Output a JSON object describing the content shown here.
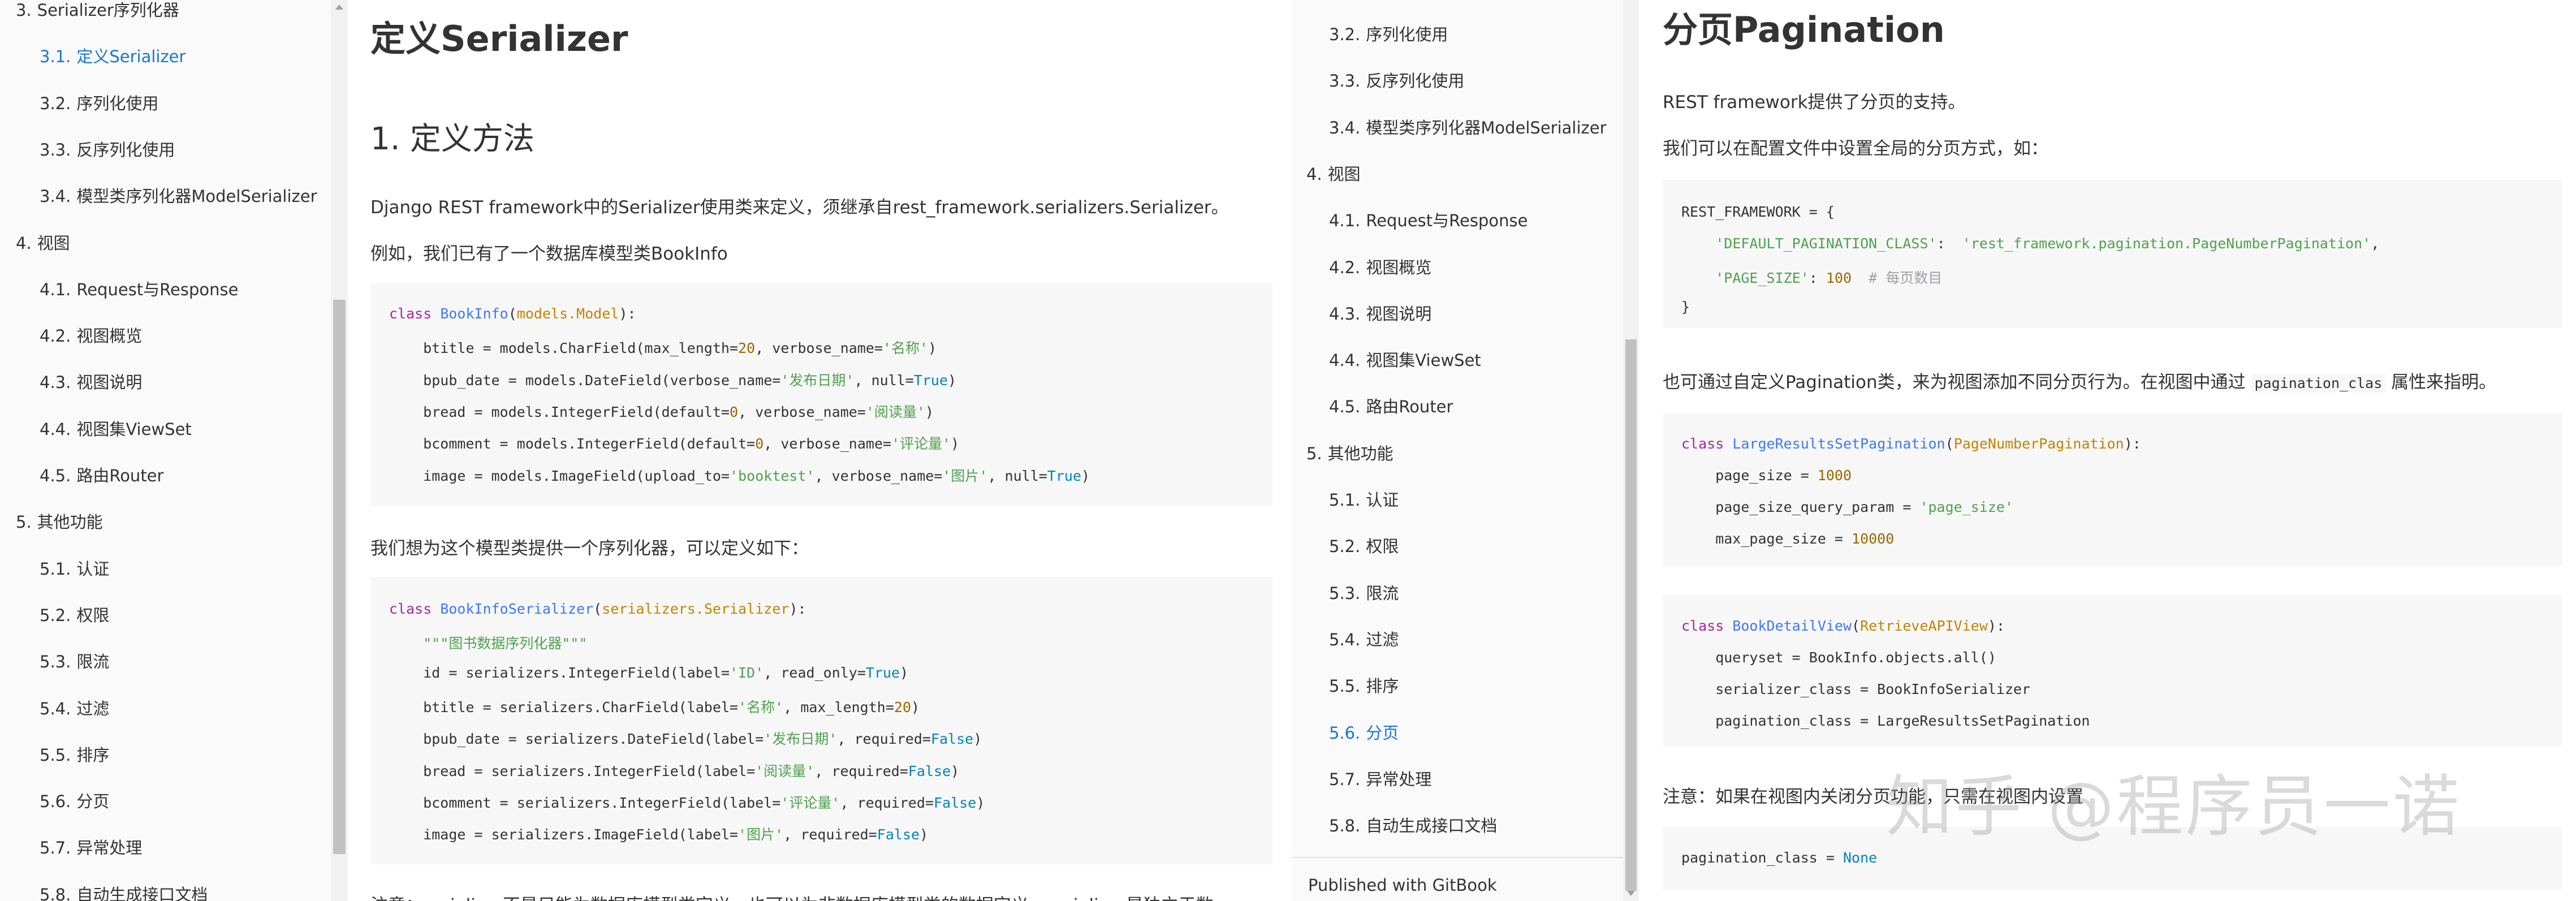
{
  "left_panel": {
    "toc": [
      {
        "num": "3.",
        "label": "Serializer序列化器",
        "level": 1,
        "active": false
      },
      {
        "num": "3.1.",
        "label": "定义Serializer",
        "level": 2,
        "active": true
      },
      {
        "num": "3.2.",
        "label": "序列化使用",
        "level": 2,
        "active": false
      },
      {
        "num": "3.3.",
        "label": "反序列化使用",
        "level": 2,
        "active": false
      },
      {
        "num": "3.4.",
        "label": "模型类序列化器ModelSerializer",
        "level": 2,
        "active": false
      },
      {
        "num": "4.",
        "label": "视图",
        "level": 1,
        "active": false
      },
      {
        "num": "4.1.",
        "label": "Request与Response",
        "level": 2,
        "active": false
      },
      {
        "num": "4.2.",
        "label": "视图概览",
        "level": 2,
        "active": false
      },
      {
        "num": "4.3.",
        "label": "视图说明",
        "level": 2,
        "active": false
      },
      {
        "num": "4.4.",
        "label": "视图集ViewSet",
        "level": 2,
        "active": false
      },
      {
        "num": "4.5.",
        "label": "路由Router",
        "level": 2,
        "active": false
      },
      {
        "num": "5.",
        "label": "其他功能",
        "level": 1,
        "active": false
      },
      {
        "num": "5.1.",
        "label": "认证",
        "level": 2,
        "active": false
      },
      {
        "num": "5.2.",
        "label": "权限",
        "level": 2,
        "active": false
      },
      {
        "num": "5.3.",
        "label": "限流",
        "level": 2,
        "active": false
      },
      {
        "num": "5.4.",
        "label": "过滤",
        "level": 2,
        "active": false
      },
      {
        "num": "5.5.",
        "label": "排序",
        "level": 2,
        "active": false
      },
      {
        "num": "5.6.",
        "label": "分页",
        "level": 2,
        "active": false
      },
      {
        "num": "5.7.",
        "label": "异常处理",
        "level": 2,
        "active": false
      },
      {
        "num": "5.8.",
        "label": "自动生成接口文档",
        "level": 2,
        "active": false
      }
    ],
    "title": "定义Serializer",
    "section": "1. 定义方法",
    "p1": "Django REST framework中的Serializer使用类来定义，须继承自rest_framework.serializers.Serializer。",
    "p2": "例如，我们已有了一个数据库模型类BookInfo",
    "code1": [
      "class BookInfo(models.Model):",
      "    btitle = models.CharField(max_length=20, verbose_name='名称')",
      "    bpub_date = models.DateField(verbose_name='发布日期', null=True)",
      "    bread = models.IntegerField(default=0, verbose_name='阅读量')",
      "    bcomment = models.IntegerField(default=0, verbose_name='评论量')",
      "    image = models.ImageField(upload_to='booktest', verbose_name='图片', null=True)"
    ],
    "p3": "我们想为这个模型类提供一个序列化器，可以定义如下：",
    "code2": [
      "class BookInfoSerializer(serializers.Serializer):",
      "    \"\"\"图书数据序列化器\"\"\"",
      "    id = serializers.IntegerField(label='ID', read_only=True)",
      "    btitle = serializers.CharField(label='名称', max_length=20)",
      "    bpub_date = serializers.DateField(label='发布日期', required=False)",
      "    bread = serializers.IntegerField(label='阅读量', required=False)",
      "    bcomment = serializers.IntegerField(label='评论量', required=False)",
      "    image = serializers.ImageField(label='图片', required=False)"
    ],
    "p4": "注意：serializer不是只能为数据库模型类定义，也可以为非数据库模型类的数据定义。serializer是独立于数"
  },
  "right_panel": {
    "toc": [
      {
        "num": "3.2.",
        "label": "序列化使用",
        "level": 2,
        "active": false
      },
      {
        "num": "3.3.",
        "label": "反序列化使用",
        "level": 2,
        "active": false
      },
      {
        "num": "3.4.",
        "label": "模型类序列化器ModelSerializer",
        "level": 2,
        "active": false
      },
      {
        "num": "4.",
        "label": "视图",
        "level": 1,
        "active": false
      },
      {
        "num": "4.1.",
        "label": "Request与Response",
        "level": 2,
        "active": false
      },
      {
        "num": "4.2.",
        "label": "视图概览",
        "level": 2,
        "active": false
      },
      {
        "num": "4.3.",
        "label": "视图说明",
        "level": 2,
        "active": false
      },
      {
        "num": "4.4.",
        "label": "视图集ViewSet",
        "level": 2,
        "active": false
      },
      {
        "num": "4.5.",
        "label": "路由Router",
        "level": 2,
        "active": false
      },
      {
        "num": "5.",
        "label": "其他功能",
        "level": 1,
        "active": false
      },
      {
        "num": "5.1.",
        "label": "认证",
        "level": 2,
        "active": false
      },
      {
        "num": "5.2.",
        "label": "权限",
        "level": 2,
        "active": false
      },
      {
        "num": "5.3.",
        "label": "限流",
        "level": 2,
        "active": false
      },
      {
        "num": "5.4.",
        "label": "过滤",
        "level": 2,
        "active": false
      },
      {
        "num": "5.5.",
        "label": "排序",
        "level": 2,
        "active": false
      },
      {
        "num": "5.6.",
        "label": "分页",
        "level": 2,
        "active": true
      },
      {
        "num": "5.7.",
        "label": "异常处理",
        "level": 2,
        "active": false
      },
      {
        "num": "5.8.",
        "label": "自动生成接口文档",
        "level": 2,
        "active": false
      }
    ],
    "published": "Published with GitBook",
    "title": "分页Pagination",
    "p1": "REST framework提供了分页的支持。",
    "p2": "我们可以在配置文件中设置全局的分页方式，如：",
    "code1": [
      "REST_FRAMEWORK = {",
      "    'DEFAULT_PAGINATION_CLASS':  'rest_framework.pagination.PageNumberPagination',",
      "    'PAGE_SIZE': 100  # 每页数目",
      "}"
    ],
    "p3_before": "也可通过自定义Pagination类，来为视图添加不同分页行为。在视图中通过",
    "p3_code": "pagination_clas",
    "p3_after": "属性来指明。",
    "code2": [
      "class LargeResultsSetPagination(PageNumberPagination):",
      "    page_size = 1000",
      "    page_size_query_param = 'page_size'",
      "    max_page_size = 10000"
    ],
    "code3": [
      "class BookDetailView(RetrieveAPIView):",
      "    queryset = BookInfo.objects.all()",
      "    serializer_class = BookInfoSerializer",
      "    pagination_class = LargeResultsSetPagination"
    ],
    "p4": "注意：如果在视图内关闭分页功能，只需在视图内设置",
    "code4": [
      "pagination_class = None"
    ]
  },
  "watermark": "知乎 @程序员一诺"
}
